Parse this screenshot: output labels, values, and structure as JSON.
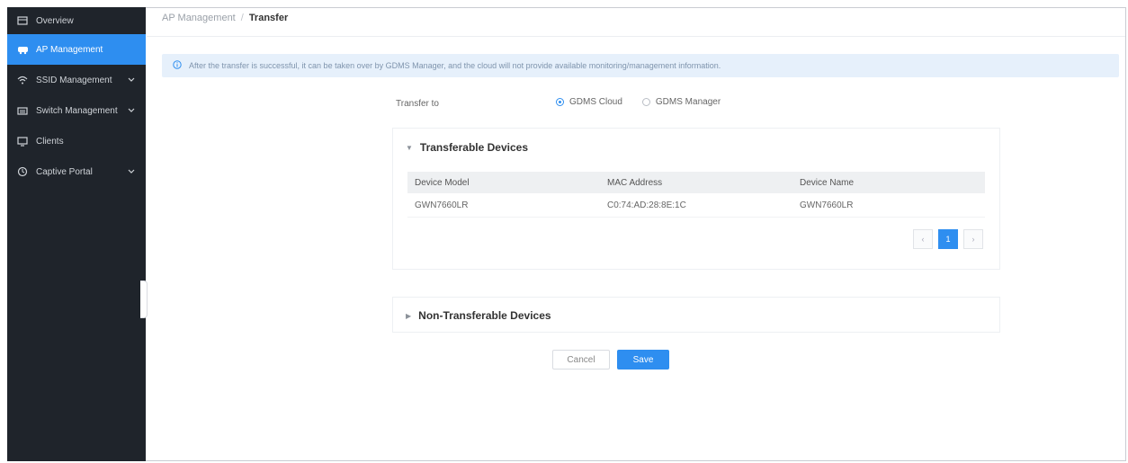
{
  "sidebar": {
    "items": [
      {
        "label": "Overview",
        "icon": "dashboard-icon"
      },
      {
        "label": "AP Management",
        "icon": "access-point-icon",
        "active": true
      },
      {
        "label": "SSID Management",
        "icon": "wifi-icon",
        "expandable": true
      },
      {
        "label": "Switch Management",
        "icon": "switch-icon",
        "expandable": true
      },
      {
        "label": "Clients",
        "icon": "clients-icon"
      },
      {
        "label": "Captive Portal",
        "icon": "portal-icon",
        "expandable": true
      }
    ]
  },
  "breadcrumb": {
    "parent": "AP Management",
    "separator": "/",
    "current": "Transfer"
  },
  "info_banner": {
    "icon": "info-icon",
    "text": "After the transfer is successful, it can be taken over by GDMS Manager, and the cloud will not provide available monitoring/management information."
  },
  "transfer": {
    "label": "Transfer to",
    "options": [
      "GDMS Cloud",
      "GDMS Manager"
    ],
    "selected": "GDMS Cloud"
  },
  "transferable": {
    "title": "Transferable Devices",
    "columns": [
      "Device Model",
      "MAC Address",
      "Device Name"
    ],
    "rows": [
      [
        "GWN7660LR",
        "C0:74:AD:28:8E:1C",
        "GWN7660LR"
      ]
    ],
    "pagination": {
      "prev": "‹",
      "current": "1",
      "next": "›"
    }
  },
  "non_transferable": {
    "title": "Non-Transferable Devices"
  },
  "actions": {
    "cancel": "Cancel",
    "save": "Save"
  },
  "colors": {
    "accent": "#2e8ef0",
    "sidebar_bg": "#1f242b",
    "banner_bg": "#e6f0fb"
  }
}
